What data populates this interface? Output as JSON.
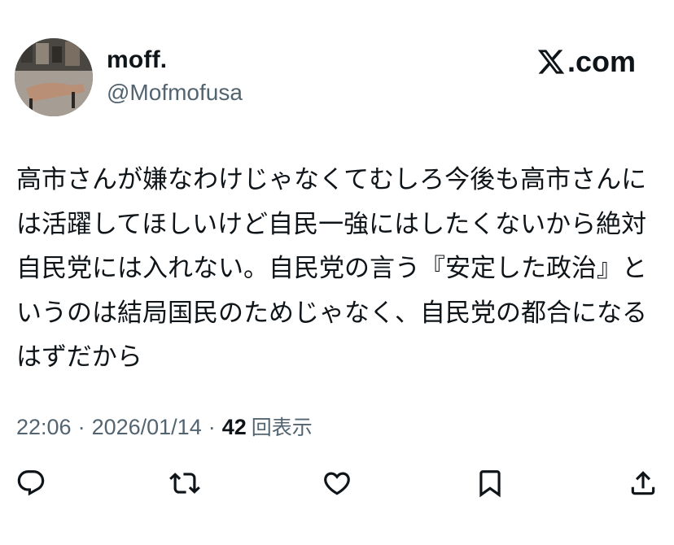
{
  "author": {
    "display_name": "moff.",
    "handle": "@Mofmofusa"
  },
  "brand": {
    "label": ".com"
  },
  "tweet": {
    "text": "高市さんが嫌なわけじゃなくてむしろ今後も高市さんには活躍してほしいけど自民一強にはしたくないから絶対自民党には入れない。自民党の言う『安定した政治』というのは結局国民のためじゃなく、自民党の都合になるはずだから"
  },
  "meta": {
    "time": "22:06",
    "separator": "·",
    "date": "2026/01/14",
    "views_count": "42",
    "views_label": "回表示"
  },
  "actions": {
    "icons": [
      "reply-icon",
      "retweet-icon",
      "like-icon",
      "bookmark-icon",
      "share-icon"
    ],
    "color": "#0f1419"
  }
}
